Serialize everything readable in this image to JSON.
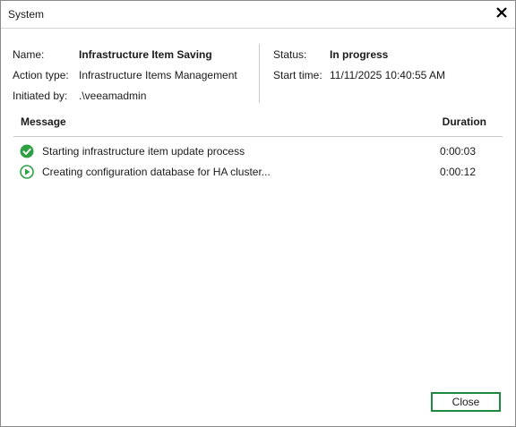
{
  "window": {
    "title": "System"
  },
  "info": {
    "name_label": "Name:",
    "name_value": "Infrastructure Item Saving",
    "action_type_label": "Action type:",
    "action_type_value": "Infrastructure Items Management",
    "initiated_by_label": "Initiated by:",
    "initiated_by_value": ".\\veeamadmin",
    "status_label": "Status:",
    "status_value": "In progress",
    "start_time_label": "Start time:",
    "start_time_value": "11/11/2025 10:40:55 AM"
  },
  "log_table": {
    "columns": {
      "message": "Message",
      "duration": "Duration"
    },
    "rows": [
      {
        "status_icon": "success-check-icon",
        "message": "Starting infrastructure item update process",
        "duration": "0:00:03"
      },
      {
        "status_icon": "running-play-icon",
        "message": "Creating configuration database for HA cluster...",
        "duration": "0:00:12"
      }
    ]
  },
  "footer": {
    "close_label": "Close"
  },
  "colors": {
    "accent_green": "#1b8a3e",
    "success_green": "#2ea043"
  }
}
